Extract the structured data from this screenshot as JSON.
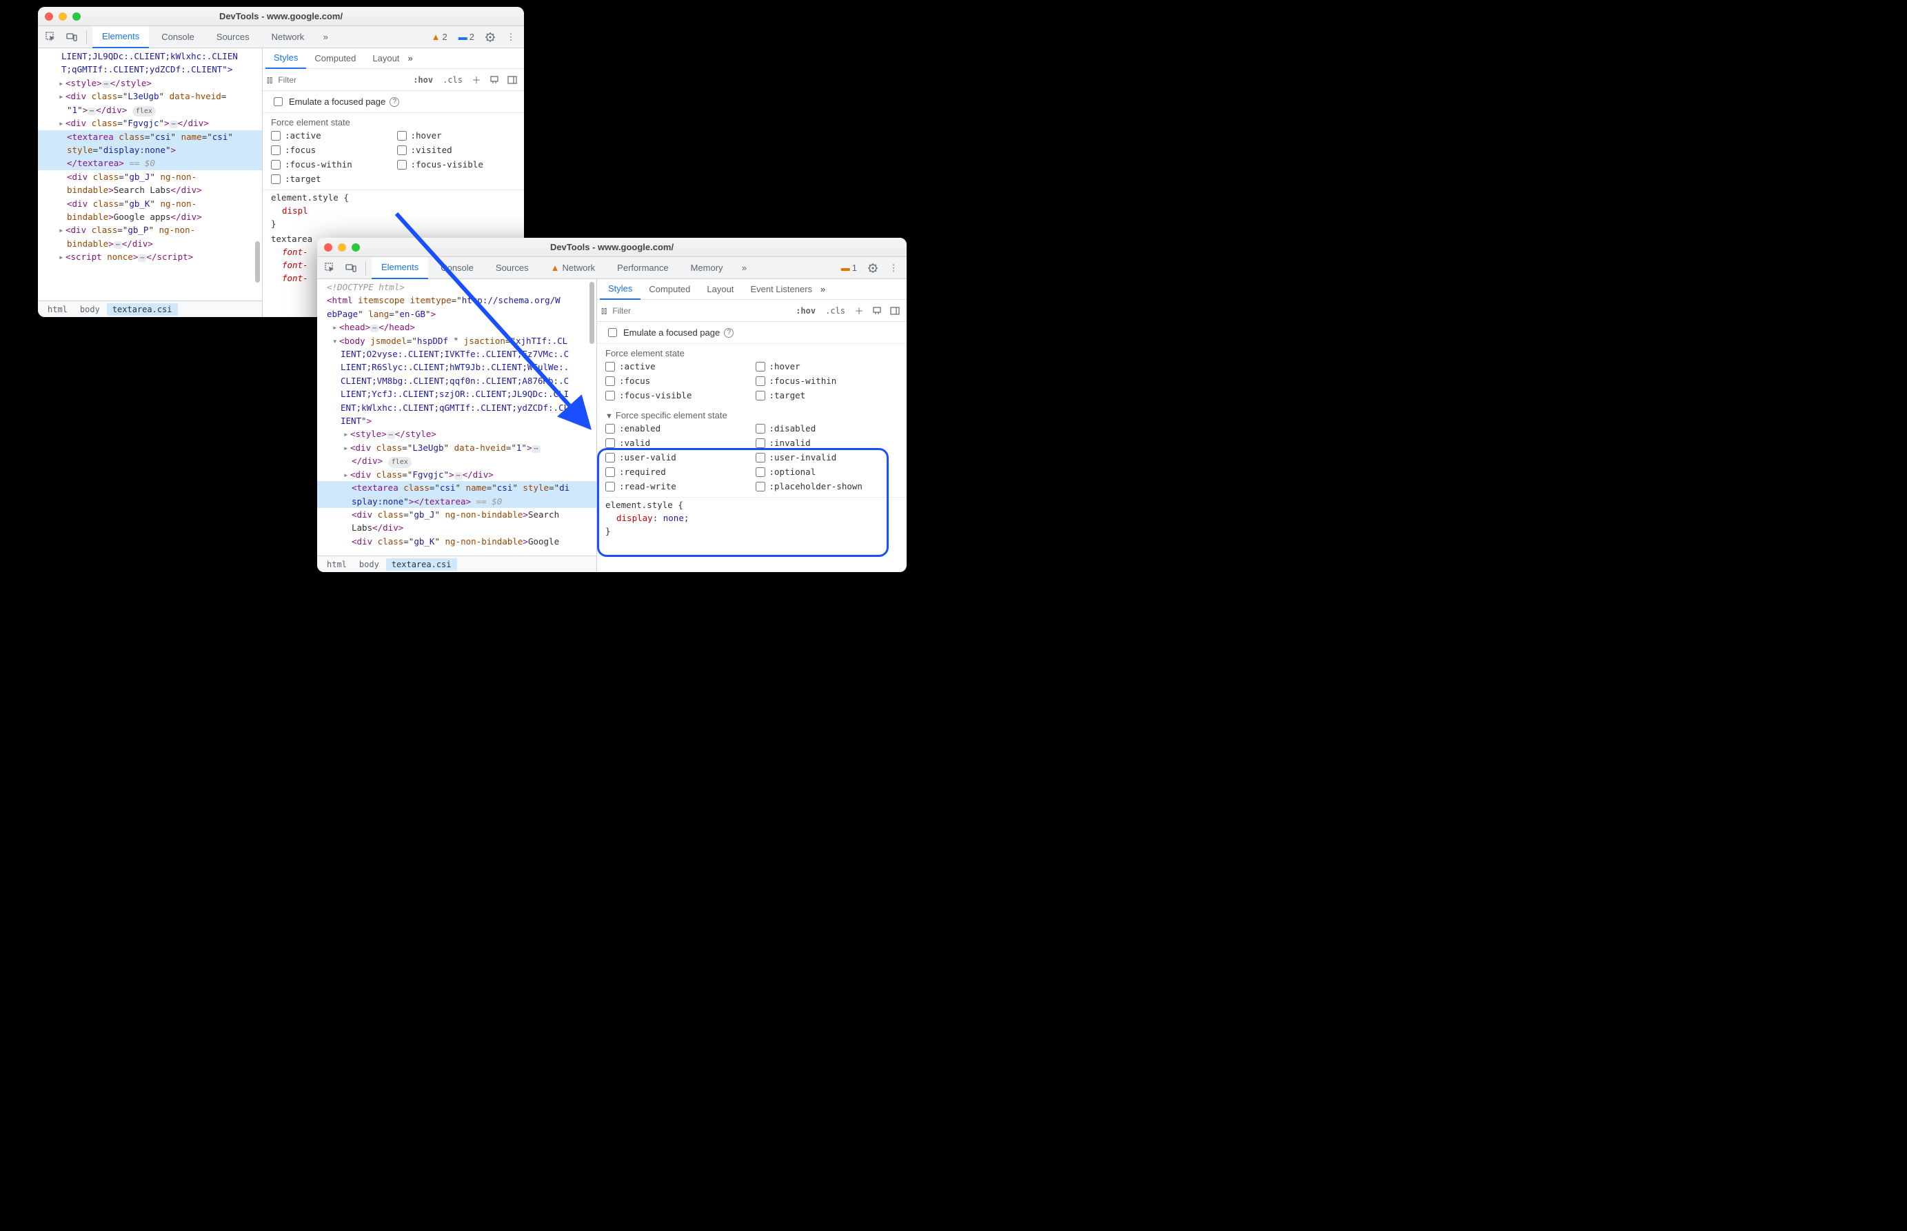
{
  "windowA": {
    "title": "DevTools - www.google.com/",
    "tabs": [
      "Elements",
      "Console",
      "Sources",
      "Network"
    ],
    "warn_count": "2",
    "issue_count": "2",
    "dom": {
      "line1a": "LIENT;JL9QDc:.CLIENT;kWlxhc:.CLIEN",
      "line1b": "T;qGMTIf:.CLIENT;ydZCDf:.CLIENT\">",
      "style_open": "<style>",
      "style_close": "</style>",
      "div_l3": "<div class=\"L3eUgb\" data-hveid=",
      "div_l3b": "\"1\">",
      "div_close": "</div>",
      "div_fg": "<div class=\"Fgvgjc\">",
      "sel_open": "<textarea class=\"csi\" name=\"csi\"",
      "sel_style": "style=\"display:none\">",
      "sel_close": "</textarea>",
      "eq0": " == $0",
      "gbJ": "<div class=\"gb_J\" ng-non-",
      "gbJ2": "bindable>Search Labs</div>",
      "gbK": "<div class=\"gb_K\" ng-non-",
      "gbK2": "bindable>Google apps</div>",
      "gbP": "<div class=\"gb_P\" ng-non-",
      "gbP2": "bindable>",
      "script": "<script nonce>",
      "script_close": "</script>",
      "flex": "flex"
    },
    "crumbs": [
      "html",
      "body",
      "textarea.csi"
    ],
    "styles": {
      "subtabs": [
        "Styles",
        "Computed",
        "Layout"
      ],
      "filter_ph": "Filter",
      "hov": ":hov",
      "cls": ".cls",
      "emulate": "Emulate a focused page",
      "force_label": "Force element state",
      "states": [
        ":active",
        ":hover",
        ":focus",
        ":visited",
        ":focus-within",
        ":focus-visible",
        ":target"
      ],
      "elstyle": "element.style {",
      "displ": "displ",
      "textarea_sel": "textarea",
      "font": "font-"
    }
  },
  "windowB": {
    "title": "DevTools - www.google.com/",
    "tabs": [
      "Elements",
      "Console",
      "Sources",
      "Network",
      "Performance",
      "Memory"
    ],
    "issue_count": "1",
    "dom": {
      "doctype": "<!DOCTYPE html>",
      "html_open": "<html itemscope itemtype=\"http://schema.org/W",
      "html_open2": "ebPage\" lang=\"en-GB\">",
      "head": "<head>",
      "head_close": "</head>",
      "body_open": "<body jsmodel=\"hspDDf \" jsaction=\"xjhTIf:.CL",
      "b2": "IENT;O2vyse:.CLIENT;IVKTfe:.CLIENT;Ez7VMc:.C",
      "b3": "LIENT;R6Slyc:.CLIENT;hWT9Jb:.CLIENT;WCulWe:.",
      "b4": "CLIENT;VM8bg:.CLIENT;qqf0n:.CLIENT;A876Rb:.C",
      "b5": "LIENT;YcfJ:.CLIENT;szjOR:.CLIENT;JL9QDc:.CLI",
      "b6": "ENT;kWlxhc:.CLIENT;qGMTIf:.CLIENT;ydZCDf:.CL",
      "b7": "IENT\">",
      "style_open": "<style>",
      "style_close": "</style>",
      "div_l3": "<div class=\"L3eUgb\" data-hveid=\"1\">",
      "div_close": "</div>",
      "div_fg": "<div class=\"Fgvgjc\">",
      "sel": "<textarea class=\"csi\" name=\"csi\" style=\"di",
      "sel2": "splay:none\"></textarea>",
      "eq0": " == $0",
      "gbJ": "<div class=\"gb_J\" ng-non-bindable>Search",
      "gbJ2": "Labs</div>",
      "gbK": "<div class=\"gb_K\" ng-non-bindable>Google",
      "flex": "flex"
    },
    "crumbs": [
      "html",
      "body",
      "textarea.csi"
    ],
    "styles": {
      "subtabs": [
        "Styles",
        "Computed",
        "Layout",
        "Event Listeners"
      ],
      "filter_ph": "Filter",
      "hov": ":hov",
      "cls": ".cls",
      "emulate": "Emulate a focused page",
      "force_label": "Force element state",
      "states": [
        ":active",
        ":hover",
        ":focus",
        ":focus-within",
        ":focus-visible",
        ":target"
      ],
      "specific_label": "Force specific element state",
      "sstates": [
        ":enabled",
        ":disabled",
        ":valid",
        ":invalid",
        ":user-valid",
        ":user-invalid",
        ":required",
        ":optional",
        ":read-write",
        ":placeholder-shown"
      ],
      "elstyle": "element.style {",
      "display_prop": "display",
      "display_val": "none"
    }
  }
}
